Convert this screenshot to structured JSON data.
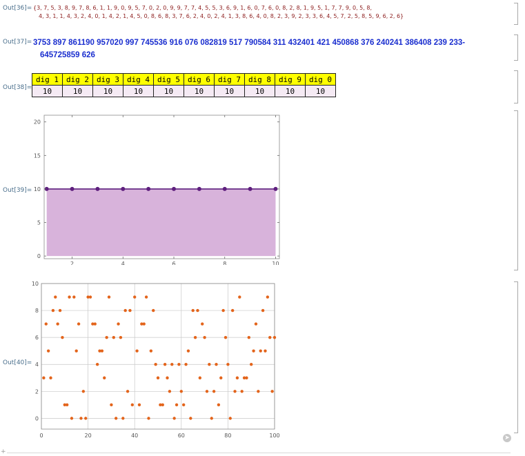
{
  "cells": {
    "out36_label": "Out[36]=",
    "out37_label": "Out[37]=",
    "out38_label": "Out[38]=",
    "out39_label": "Out[39]=",
    "out40_label": "Out[40]="
  },
  "out36": {
    "line1": "{3, 7, 5, 3, 8, 9, 7, 8, 6, 1, 1, 9, 0, 9, 5, 7, 0, 2, 0, 9, 9, 7, 7, 4, 5, 5, 3, 6, 9, 1, 6, 0, 7, 6, 0, 8, 2, 8, 1, 9, 5, 1, 7, 7, 9, 0, 5, 8,",
    "line2": "4, 3, 1, 1, 4, 3, 2, 4, 0, 1, 4, 2, 1, 4, 5, 0, 8, 6, 8, 3, 7, 6, 2, 4, 0, 2, 4, 1, 3, 8, 6, 4, 0, 8, 2, 3, 9, 2, 3, 3, 6, 4, 5, 7, 2, 5, 8, 5, 9, 6, 2, 6}"
  },
  "out37": {
    "line1": "3753 897 861190 957020 997 745536 916 076 082819 517 790584 311 432401 421 450868 376 240241 386408 239 233-",
    "line2": "645725859 626"
  },
  "out38": {
    "headers": [
      "dig 1",
      "dig 2",
      "dig 3",
      "dig 4",
      "dig 5",
      "dig 6",
      "dig 7",
      "dig 8",
      "dig 9",
      "dig 0"
    ],
    "values": [
      "10",
      "10",
      "10",
      "10",
      "10",
      "10",
      "10",
      "10",
      "10",
      "10"
    ]
  },
  "icons": {
    "open-arrow": "circle-arrow-icon",
    "plus": "plus-icon"
  },
  "plus_text": "+",
  "chart_data": [
    {
      "type": "area",
      "title": "",
      "xlabel": "",
      "ylabel": "",
      "x": [
        1,
        2,
        3,
        4,
        5,
        6,
        7,
        8,
        9,
        10
      ],
      "series": [
        {
          "values": [
            10,
            10,
            10,
            10,
            10,
            10,
            10,
            10,
            10,
            10
          ]
        }
      ],
      "xlim": [
        0.9,
        10.15
      ],
      "ylim": [
        -0.4,
        21
      ],
      "xticks": [
        2,
        4,
        6,
        8,
        10
      ],
      "yticks": [
        0,
        5,
        10,
        15,
        20
      ],
      "colors": {
        "line": "#5e1f7e",
        "fill": "#d8b3db",
        "frame": "#8a8a8a"
      }
    },
    {
      "type": "scatter",
      "title": "",
      "xlabel": "",
      "ylabel": "",
      "x": [
        1,
        2,
        3,
        4,
        5,
        6,
        7,
        8,
        9,
        10,
        11,
        12,
        13,
        14,
        15,
        16,
        17,
        18,
        19,
        20,
        21,
        22,
        23,
        24,
        25,
        26,
        27,
        28,
        29,
        30,
        31,
        32,
        33,
        34,
        35,
        36,
        37,
        38,
        39,
        40,
        41,
        42,
        43,
        44,
        45,
        46,
        47,
        48,
        49,
        50,
        51,
        52,
        53,
        54,
        55,
        56,
        57,
        58,
        59,
        60,
        61,
        62,
        63,
        64,
        65,
        66,
        67,
        68,
        69,
        70,
        71,
        72,
        73,
        74,
        75,
        76,
        77,
        78,
        79,
        80,
        81,
        82,
        83,
        84,
        85,
        86,
        87,
        88,
        89,
        90,
        91,
        92,
        93,
        94,
        95,
        96,
        97,
        98,
        99,
        100
      ],
      "values": [
        3,
        7,
        5,
        3,
        8,
        9,
        7,
        8,
        6,
        1,
        1,
        9,
        0,
        9,
        5,
        7,
        0,
        2,
        0,
        9,
        9,
        7,
        7,
        4,
        5,
        5,
        3,
        6,
        9,
        1,
        6,
        0,
        7,
        6,
        0,
        8,
        2,
        8,
        1,
        9,
        5,
        1,
        7,
        7,
        9,
        0,
        5,
        8,
        4,
        3,
        1,
        1,
        4,
        3,
        2,
        4,
        0,
        1,
        4,
        2,
        1,
        4,
        5,
        0,
        8,
        6,
        8,
        3,
        7,
        6,
        2,
        4,
        0,
        2,
        4,
        1,
        3,
        8,
        6,
        4,
        0,
        8,
        2,
        3,
        9,
        2,
        3,
        3,
        6,
        4,
        5,
        7,
        2,
        5,
        8,
        5,
        9,
        6,
        2,
        6
      ],
      "xlim": [
        0,
        100
      ],
      "ylim": [
        -0.8,
        10
      ],
      "xticks": [
        0,
        20,
        40,
        60,
        80,
        100
      ],
      "yticks": [
        0,
        2,
        4,
        6,
        8,
        10
      ],
      "grid": true,
      "colors": {
        "point": "#e3641b",
        "grid": "#c8c8c8",
        "frame": "#8a8a8a"
      }
    }
  ]
}
